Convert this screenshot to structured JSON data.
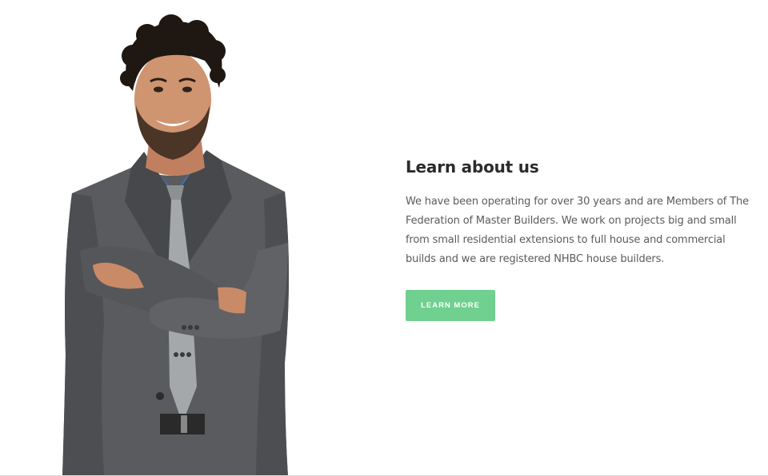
{
  "about": {
    "heading": "Learn about us",
    "body": "We have been operating for over 30 years and are Members of The Federation of Master Builders. We work on projects big and small from small residential extensions to full house and commercial builds and we are registered NHBC house builders.",
    "cta_label": "LEARN MORE"
  },
  "colors": {
    "cta_background": "#6fd08f",
    "heading": "#2b2b2b",
    "body_text": "#5b5b5b"
  }
}
